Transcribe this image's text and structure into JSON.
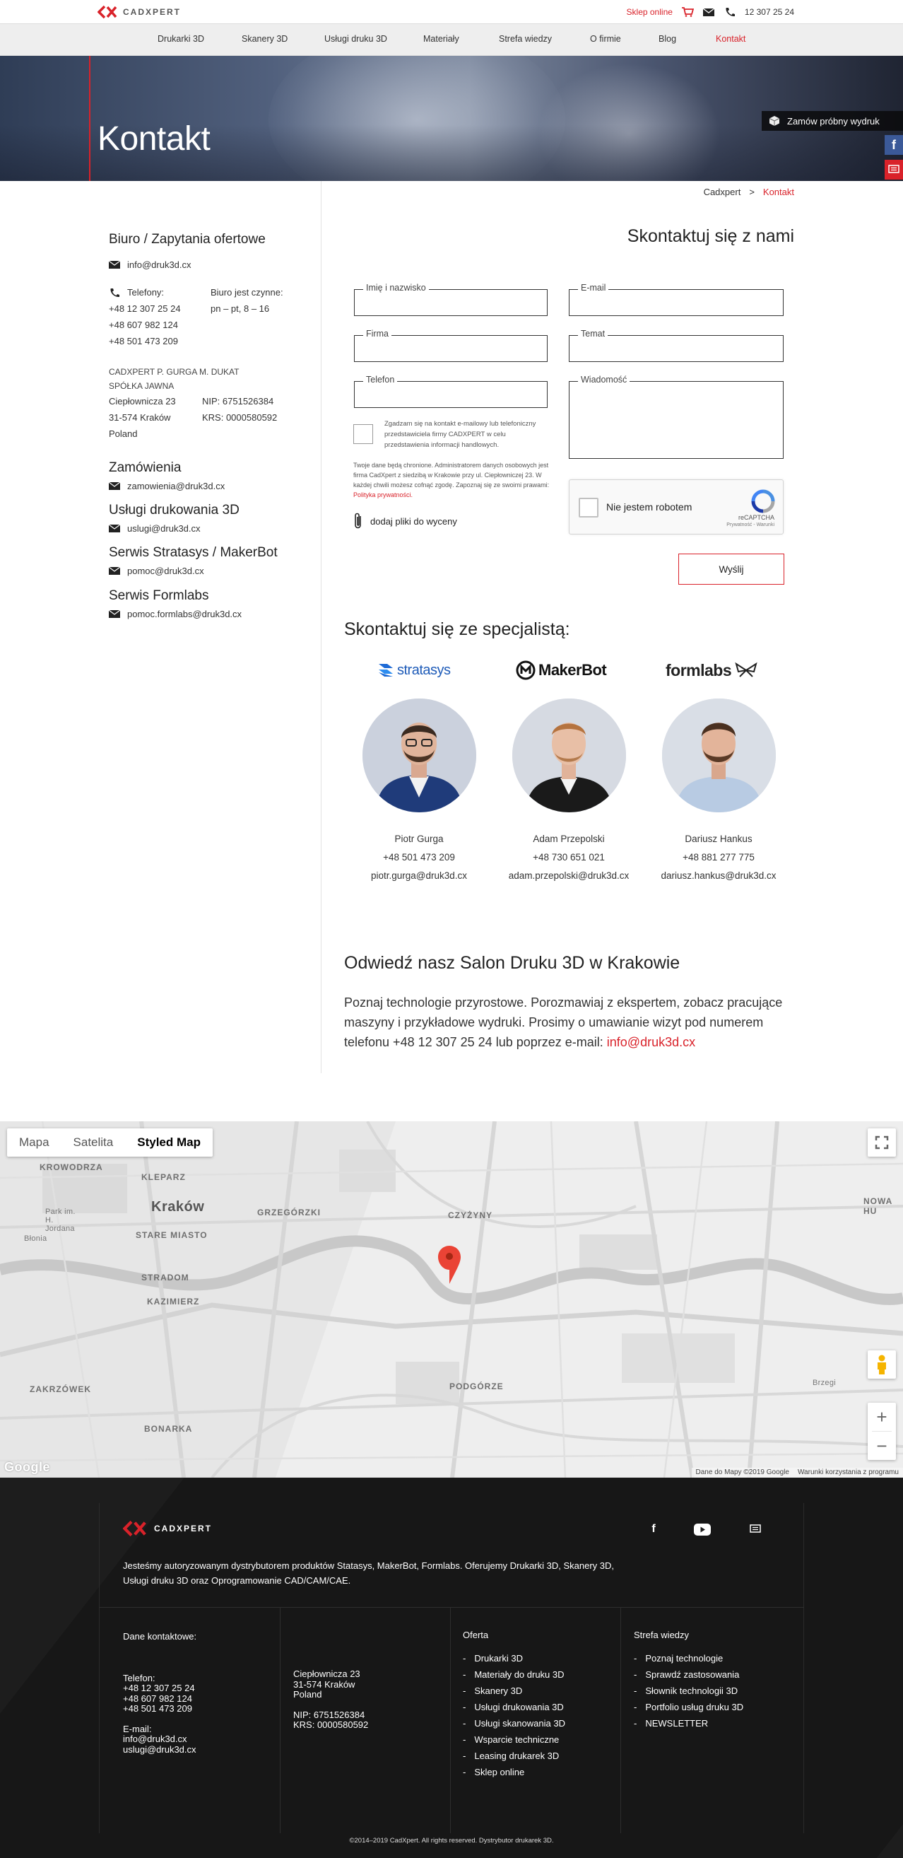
{
  "brand": {
    "logo_text": "CADXPERT",
    "accent": "#d9222a"
  },
  "topbar": {
    "shop_label": "Sklep online",
    "phone": "12 307 25 24"
  },
  "nav": {
    "items": [
      "Drukarki 3D",
      "Skanery 3D",
      "Usługi druku 3D",
      "Materiały",
      "Strefa wiedzy",
      "O firmie",
      "Blog",
      "Kontakt"
    ],
    "active": "Kontakt"
  },
  "hero": {
    "title": "Kontakt",
    "sample_button": "Zamów próbny wydruk"
  },
  "breadcrumb": {
    "home": "Cadxpert",
    "sep": ">",
    "current": "Kontakt"
  },
  "office": {
    "title": "Biuro / Zapytania ofertowe",
    "email": "info@druk3d.cx",
    "phones_label": "Telefony:",
    "phones": [
      "+48 12 307 25 24",
      "+48 607 982 124",
      "+48 501 473 209"
    ],
    "hours_label": "Biuro jest czynne:",
    "hours": "pn – pt, 8 – 16",
    "company_line1": "CADXPERT P. GURGA M. DUKAT",
    "company_line2": "SPÓŁKA JAWNA",
    "address": [
      "Ciepłownicza 23",
      "31-574 Kraków",
      "Poland"
    ],
    "nip": "NIP: 6751526384",
    "krs": "KRS: 0000580592"
  },
  "departments": [
    {
      "title": "Zamówienia",
      "email": "zamowienia@druk3d.cx"
    },
    {
      "title": "Usługi drukowania 3D",
      "email": "uslugi@druk3d.cx"
    },
    {
      "title": "Serwis Stratasys / MakerBot",
      "email": "pomoc@druk3d.cx"
    },
    {
      "title": "Serwis Formlabs",
      "email": "pomoc.formlabs@druk3d.cx"
    }
  ],
  "form": {
    "title": "Skontaktuj się z nami",
    "name_label": "Imię i nazwisko",
    "email_label": "E-mail",
    "company_label": "Firma",
    "subject_label": "Temat",
    "phone_label": "Telefon",
    "message_label": "Wiadomość",
    "consent": "Zgadzam się na kontakt e-mailowy lub telefoniczny przedstawiciela firmy CADXPERT w celu przedstawienia informacji handlowych.",
    "privacy": "Twoje dane będą chronione. Administratorem danych osobowych jest firma CadXpert z siedzibą w Krakowie przy ul. Ciepłowniczej 23. W każdej chwili możesz cofnąć zgodę. Zapoznaj się ze swoimi prawami:",
    "privacy_link": "Polityka prywatności.",
    "attach": "dodaj pliki do wyceny",
    "captcha_label": "Nie jestem robotem",
    "captcha_brand": "reCAPTCHA",
    "captcha_terms": "Prywatność - Warunki",
    "send": "Wyślij"
  },
  "specialists": {
    "title": "Skontaktuj się ze specjalistą:",
    "people": [
      {
        "brand": "stratasys",
        "name": "Piotr Gurga",
        "phone": "+48 501 473 209",
        "email": "piotr.gurga@druk3d.cx"
      },
      {
        "brand": "MakerBot",
        "name": "Adam Przepolski",
        "phone": "+48 730 651 021",
        "email": "adam.przepolski@druk3d.cx"
      },
      {
        "brand": "formlabs",
        "name": "Dariusz Hankus",
        "phone": "+48 881 277 775",
        "email": "dariusz.hankus@druk3d.cx"
      }
    ]
  },
  "salon": {
    "title": "Odwiedź nasz Salon Druku 3D w Krakowie",
    "text": "Poznaj technologie przyrostowe. Porozmawiaj z ekspertem, zobacz pracujące maszyny i przykładowe wydruki. Prosimy o umawianie wizyt pod numerem telefonu +48 12 307 25 24 lub poprzez e-mail:",
    "email": "info@druk3d.cx"
  },
  "map": {
    "tabs": [
      "Mapa",
      "Satelita",
      "Styled Map"
    ],
    "selected_tab": "Styled Map",
    "labels": {
      "krowodrza": "KROWODRZA",
      "kleparz": "KLEPARZ",
      "krakow": "Kraków",
      "grzegorzki": "GRZEGÓRZKI",
      "stare_miasto": "STARE MIASTO",
      "czyzyny": "CZYŻYNY",
      "stradom": "STRADOM",
      "kazimierz": "KAZIMIERZ",
      "zakrzowek": "ZAKRZÓWEK",
      "bonarka": "BONARKA",
      "podgorze": "PODGÓRZE",
      "nowa_huta": "NOWA HU",
      "park": "Park im. H. Jordana",
      "blonia": "Błonia",
      "brzegi": "Brzegi"
    },
    "footer_data": "Dane do Mapy ©2019 Google",
    "footer_terms": "Warunki korzystania z programu",
    "google": "Google"
  },
  "footer": {
    "logo_text": "CADXPERT",
    "description": "Jesteśmy autoryzowanym dystrybutorem produktów Statasys, MakerBot, Formlabs. Oferujemy Drukarki 3D, Skanery 3D, Usługi druku 3D oraz Oprogramowanie CAD/CAM/CAE.",
    "contact_title": "Dane kontaktowe:",
    "phone_label": "Telefon:",
    "phones": [
      "+48 12 307 25 24",
      "+48 607 982 124",
      "+48 501 473 209"
    ],
    "email_label": "E-mail:",
    "emails": [
      "info@druk3d.cx",
      "uslugi@druk3d.cx"
    ],
    "address": [
      "Ciepłownicza 23",
      "31-574 Kraków",
      "Poland"
    ],
    "nip": "NIP: 6751526384",
    "krs": "KRS: 0000580592",
    "offer_title": "Oferta",
    "offer": [
      "Drukarki 3D",
      "Materiały do druku 3D",
      "Skanery 3D",
      "Usługi drukowania 3D",
      "Usługi skanowania 3D",
      "Wsparcie techniczne",
      "Leasing drukarek 3D",
      "Sklep online"
    ],
    "knowledge_title": "Strefa wiedzy",
    "knowledge": [
      "Poznaj technologie",
      "Sprawdź zastosowania",
      "Słownik technologii 3D",
      "Portfolio usług druku 3D",
      "NEWSLETTER"
    ],
    "copyright": "©2014–2019 CadXpert. All rights reserved. Dystrybutor drukarek 3D."
  }
}
